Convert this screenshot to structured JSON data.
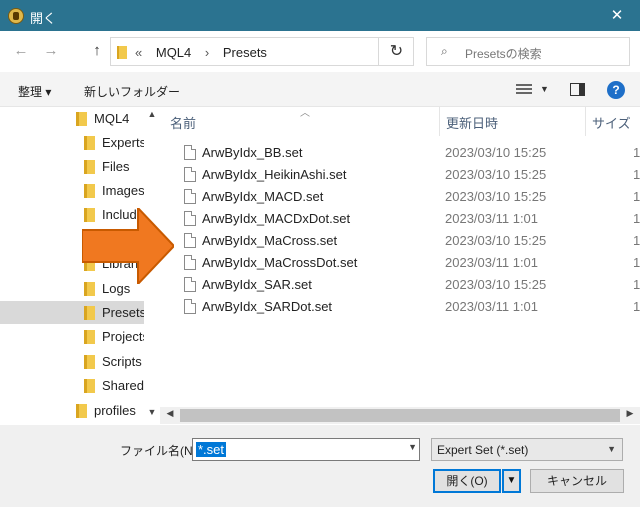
{
  "window": {
    "title": "開く",
    "close_glyph": "✕"
  },
  "nav": {
    "back_glyph": "←",
    "forward_glyph": "→",
    "up_glyph": "↑",
    "breadcrumb_overflow": "«",
    "breadcrumbs": [
      "MQL4",
      "Presets"
    ],
    "breadcrumb_sep": "›",
    "refresh_glyph": "↻",
    "search_placeholder": "Presetsの検索"
  },
  "toolbar": {
    "organize_label": "整理 ▾",
    "new_folder_label": "新しいフォルダー"
  },
  "sidebar": {
    "items": [
      {
        "label": "MQL4",
        "selected": false
      },
      {
        "label": "Experts",
        "selected": false
      },
      {
        "label": "Files",
        "selected": false
      },
      {
        "label": "Images",
        "selected": false
      },
      {
        "label": "Include",
        "selected": false
      },
      {
        "label": "",
        "selected": false
      },
      {
        "label": "Libraries",
        "selected": false
      },
      {
        "label": "Logs",
        "selected": false
      },
      {
        "label": "Presets",
        "selected": true
      },
      {
        "label": "Projects",
        "selected": false
      },
      {
        "label": "Scripts",
        "selected": false
      },
      {
        "label": "Shared",
        "selected": false
      },
      {
        "label": "profiles",
        "selected": false
      }
    ]
  },
  "columns": {
    "name": "名前",
    "date": "更新日時",
    "size": "サイズ"
  },
  "files": [
    {
      "name": "ArwByIdx_BB.set",
      "date": "2023/03/10 15:25",
      "size": "1"
    },
    {
      "name": "ArwByIdx_HeikinAshi.set",
      "date": "2023/03/10 15:25",
      "size": "1"
    },
    {
      "name": "ArwByIdx_MACD.set",
      "date": "2023/03/10 15:25",
      "size": "1"
    },
    {
      "name": "ArwByIdx_MACDxDot.set",
      "date": "2023/03/11 1:01",
      "size": "1"
    },
    {
      "name": "ArwByIdx_MaCross.set",
      "date": "2023/03/10 15:25",
      "size": "1"
    },
    {
      "name": "ArwByIdx_MaCrossDot.set",
      "date": "2023/03/11 1:01",
      "size": "1"
    },
    {
      "name": "ArwByIdx_SAR.set",
      "date": "2023/03/10 15:25",
      "size": "1"
    },
    {
      "name": "ArwByIdx_SARDot.set",
      "date": "2023/03/11 1:01",
      "size": "1"
    }
  ],
  "footer": {
    "filename_label": "ファイル名(N):",
    "filename_value": "*.set",
    "filter_value": "Expert Set (*.set)",
    "open_label": "開く(O)",
    "cancel_label": "キャンセル"
  },
  "colors": {
    "titlebar": "#2b7390",
    "accent": "#0078d7",
    "annotation_arrow": "#f07820"
  }
}
